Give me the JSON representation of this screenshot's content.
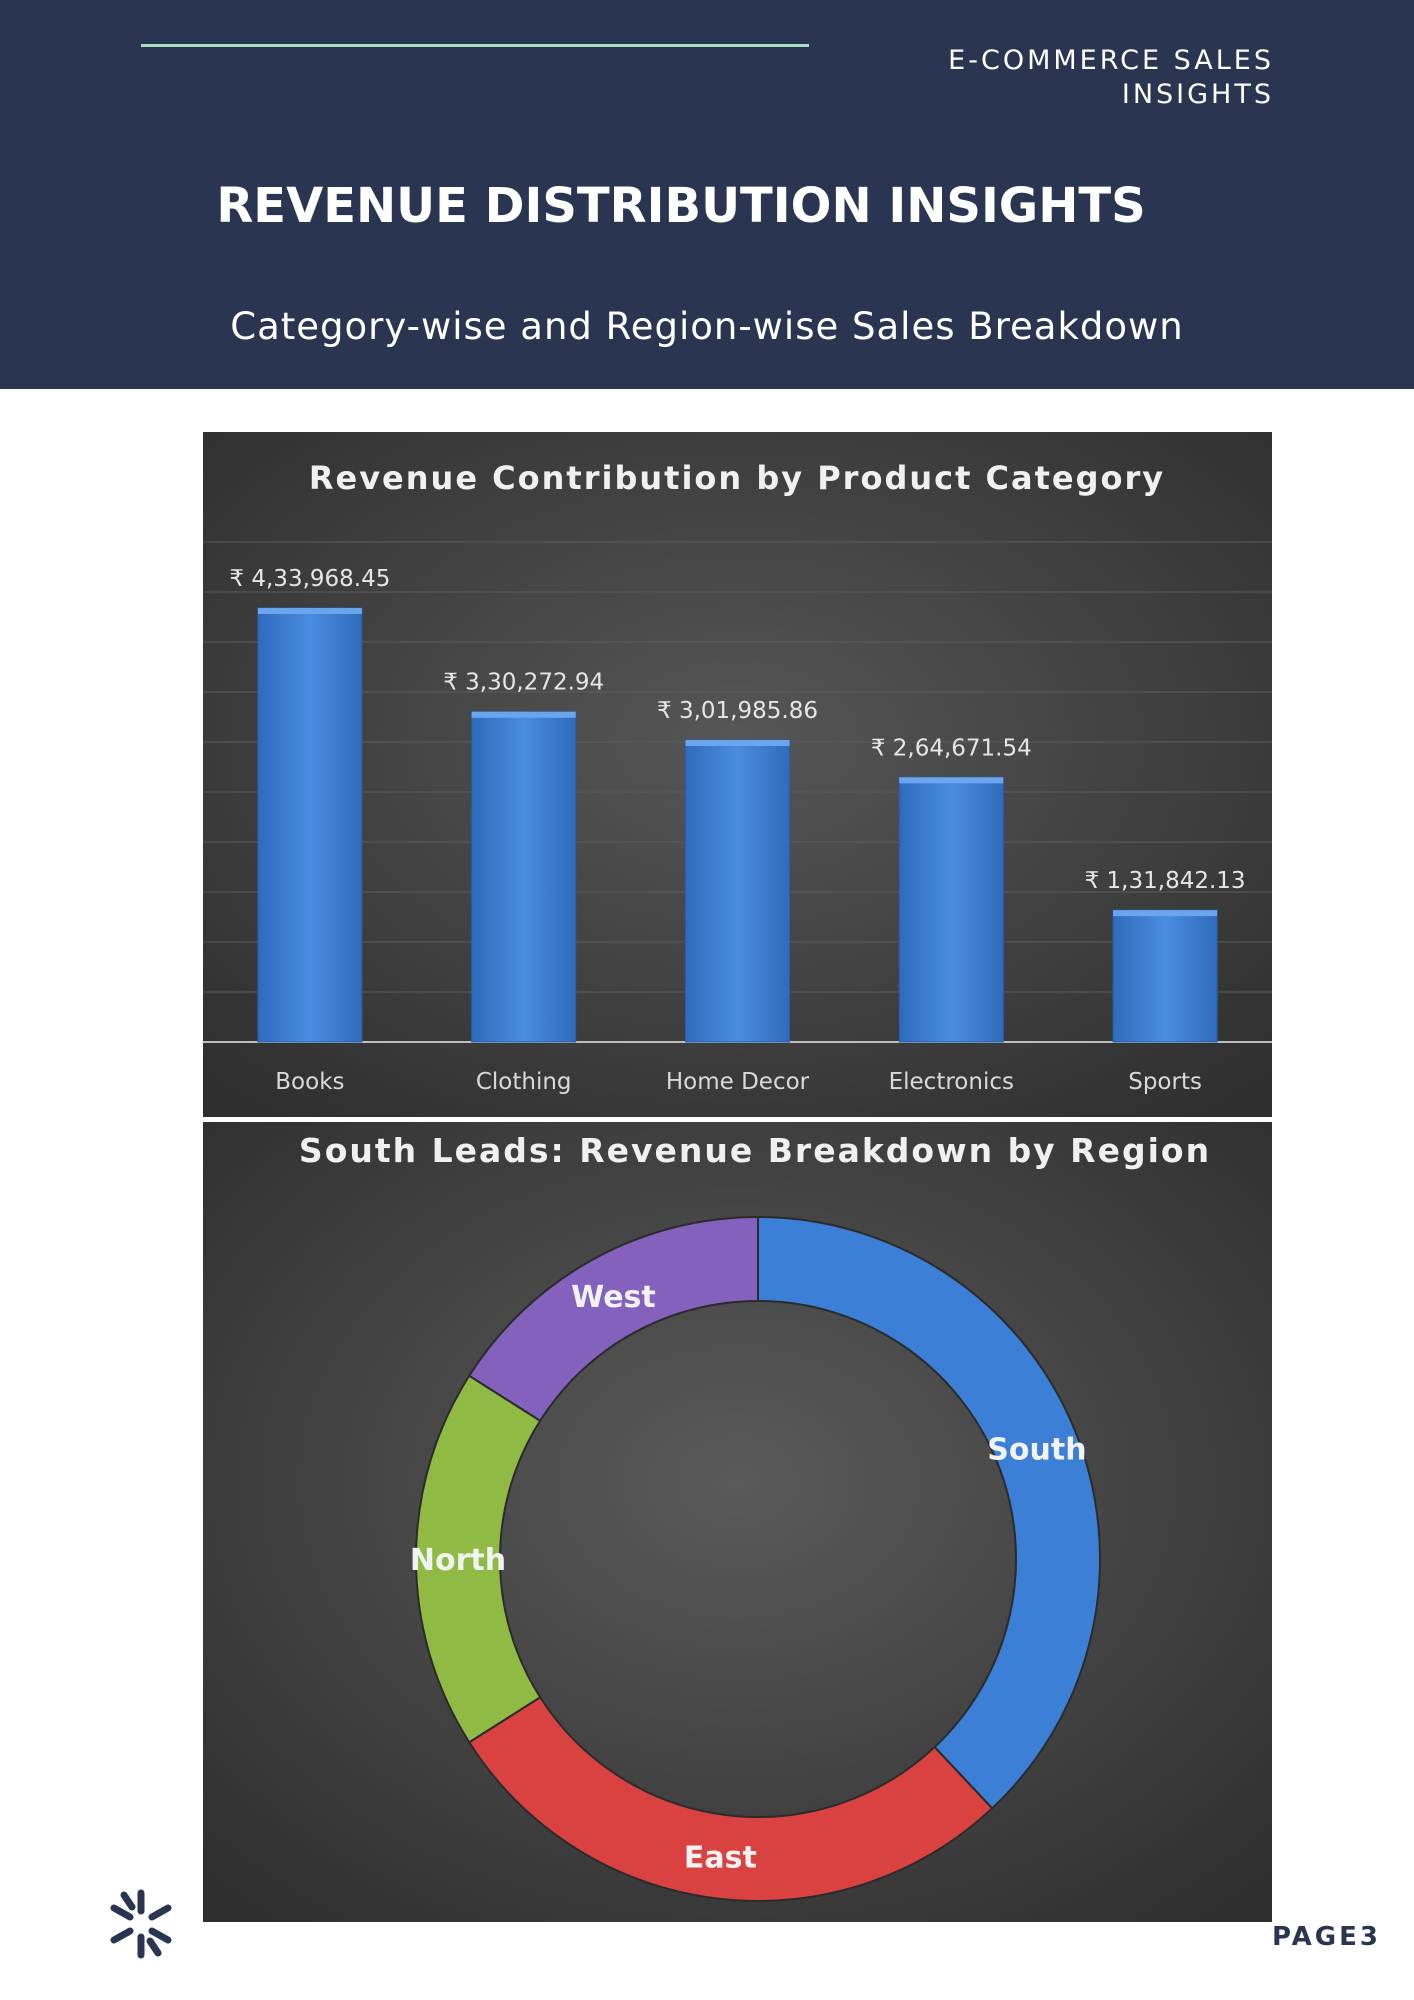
{
  "header": {
    "brand_line1": "E-COMMERCE SALES",
    "brand_line2": "INSIGHTS",
    "title": "REVENUE DISTRIBUTION INSIGHTS",
    "subtitle": "Category-wise and Region-wise Sales Breakdown"
  },
  "colors": {
    "header_bg": "#2a3552",
    "accent": "#a6dfc0",
    "bar": "#3b7fd6",
    "south": "#3b7fd6",
    "east": "#d94241",
    "north": "#8fbb45",
    "west": "#8561be"
  },
  "chart_data": [
    {
      "type": "bar",
      "title": "Revenue Contribution by Product Category",
      "categories": [
        "Books",
        "Clothing",
        "Home Decor",
        "Electronics",
        "Sports"
      ],
      "values": [
        433968.45,
        330272.94,
        301985.86,
        264671.54,
        131842.13
      ],
      "data_labels": [
        "₹ 4,33,968.45",
        "₹ 3,30,272.94",
        "₹ 3,01,985.86",
        "₹ 2,64,671.54",
        "₹ 1,31,842.13"
      ],
      "ylim": [
        0,
        500000
      ],
      "grid": true
    },
    {
      "type": "pie",
      "variant": "donut",
      "title": "South Leads: Revenue Breakdown by Region",
      "labels": [
        "South",
        "East",
        "North",
        "West"
      ],
      "values": [
        0.38,
        0.28,
        0.18,
        0.16
      ]
    }
  ],
  "footer": {
    "page_label": "PAGE3",
    "logo_icon": "snowflake-logo-icon"
  }
}
